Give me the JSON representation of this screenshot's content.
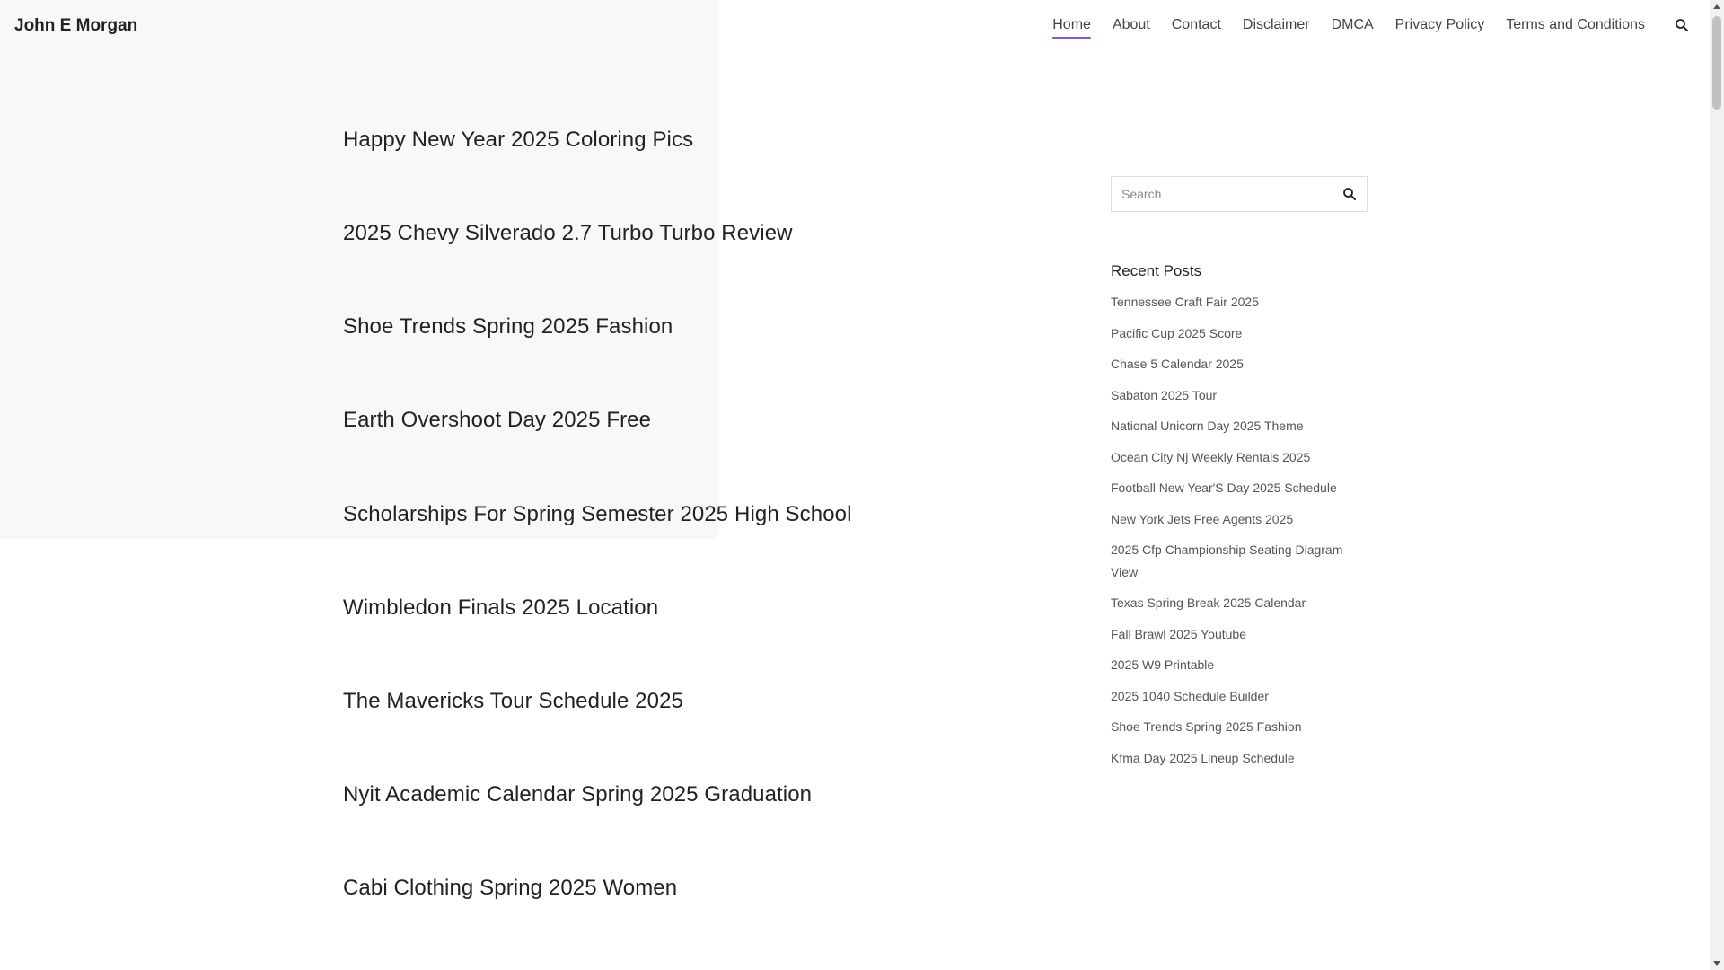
{
  "header": {
    "site_title": "John E Morgan",
    "nav": [
      {
        "label": "Home",
        "active": true
      },
      {
        "label": "About"
      },
      {
        "label": "Contact"
      },
      {
        "label": "Disclaimer"
      },
      {
        "label": "DMCA"
      },
      {
        "label": "Privacy Policy"
      },
      {
        "label": "Terms and Conditions"
      }
    ],
    "search_icon": "search-icon"
  },
  "posts": [
    "Happy New Year 2025 Coloring Pics",
    "2025 Chevy Silverado 2.7 Turbo Turbo Review",
    "Shoe Trends Spring 2025 Fashion",
    "Earth Overshoot Day 2025 Free",
    "Scholarships For Spring Semester 2025 High School",
    "Wimbledon Finals 2025 Location",
    "The Mavericks Tour Schedule 2025",
    "Nyit Academic Calendar Spring 2025 Graduation",
    "Cabi Clothing Spring 2025 Women"
  ],
  "sidebar": {
    "search_placeholder": "Search",
    "search_value": "",
    "recent_posts_title": "Recent Posts",
    "recent_posts": [
      "Tennessee Craft Fair 2025",
      "Pacific Cup 2025 Score",
      "Chase 5 Calendar 2025",
      "Sabaton 2025 Tour",
      "National Unicorn Day 2025 Theme",
      "Ocean City Nj Weekly Rentals 2025",
      "Football New Year'S Day 2025 Schedule",
      "New York Jets Free Agents 2025",
      "2025 Cfp Championship Seating Diagram View",
      "Texas Spring Break 2025 Calendar",
      "Fall Brawl 2025 Youtube",
      "2025 W9 Printable",
      "2025 1040 Schedule Builder",
      "Shoe Trends Spring 2025 Fashion",
      "Kfma Day 2025 Lineup Schedule"
    ]
  },
  "colors": {
    "accent": "#8a55d6",
    "text": "#222222",
    "muted_text": "#555555"
  }
}
